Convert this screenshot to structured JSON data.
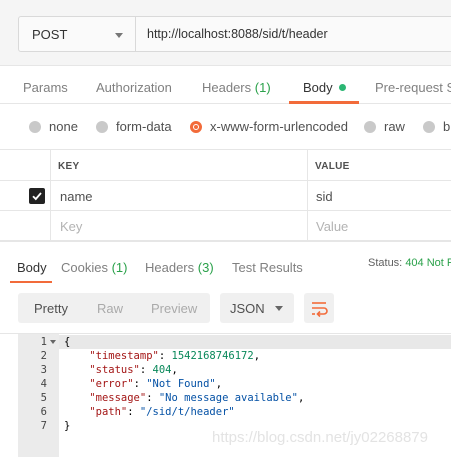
{
  "request": {
    "method": "POST",
    "url": "http://localhost:8088/sid/t/header"
  },
  "request_tabs": {
    "params": "Params",
    "authorization": "Authorization",
    "headers": "Headers",
    "headers_count": "(1)",
    "body": "Body",
    "pre_request": "Pre-request Sc"
  },
  "body_types": {
    "none": "none",
    "form_data": "form-data",
    "urlencoded": "x-www-form-urlencoded",
    "raw": "raw",
    "binary": "bi"
  },
  "params_table": {
    "key_header": "KEY",
    "value_header": "VALUE",
    "rows": [
      {
        "key": "name",
        "value": "sid",
        "checked": true
      }
    ],
    "placeholder_key": "Key",
    "placeholder_value": "Value"
  },
  "response_tabs": {
    "body": "Body",
    "cookies": "Cookies",
    "cookies_count": "(1)",
    "headers": "Headers",
    "headers_count": "(3)",
    "test_results": "Test Results",
    "status_label": "Status:",
    "status_value": "404 Not F"
  },
  "response_toolbar": {
    "pretty": "Pretty",
    "raw": "Raw",
    "preview": "Preview",
    "format": "JSON"
  },
  "response_body": {
    "line_numbers": [
      "1",
      "2",
      "3",
      "4",
      "5",
      "6",
      "7"
    ],
    "open_brace": "{",
    "close_brace": "}",
    "timestamp_key": "\"timestamp\"",
    "timestamp_value": "1542168746172",
    "status_key": "\"status\"",
    "status_value": "404",
    "error_key": "\"error\"",
    "error_value": "\"Not Found\"",
    "message_key": "\"message\"",
    "message_value": "\"No message available\"",
    "path_key": "\"path\"",
    "path_value": "\"/sid/t/header\""
  },
  "watermark": "https://blog.csdn.net/jy02268879",
  "colors": {
    "accent": "#f26b3a",
    "green": "#2aa14a",
    "json_key": "#a31515",
    "json_number": "#09885a",
    "json_string": "#0451a5"
  }
}
